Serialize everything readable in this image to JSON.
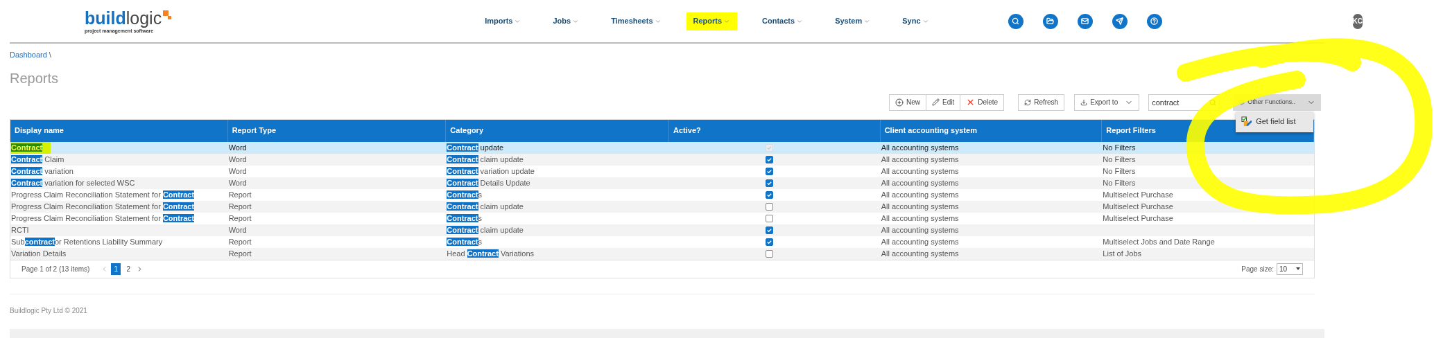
{
  "header": {
    "logo": {
      "brand_bold": "build",
      "brand_light": "logic",
      "tagline": "project management software"
    },
    "nav": [
      {
        "label": "Imports",
        "highlighted": false
      },
      {
        "label": "Jobs",
        "highlighted": false
      },
      {
        "label": "Timesheets",
        "highlighted": false
      },
      {
        "label": "Reports",
        "highlighted": true
      },
      {
        "label": "Contacts",
        "highlighted": false
      },
      {
        "label": "System",
        "highlighted": false
      },
      {
        "label": "Sync",
        "highlighted": false
      }
    ],
    "avatar": {
      "initials": "KC"
    }
  },
  "breadcrumb": {
    "items": [
      "Dashboard"
    ],
    "separator": "\\"
  },
  "page_title": "Reports",
  "toolbar": {
    "buttons": [
      "New",
      "Edit",
      "Delete"
    ],
    "refresh": "Refresh",
    "export": "Export to",
    "search": {
      "value": "contract"
    },
    "other_functions": {
      "label": "Other Functions..",
      "expanded": true,
      "menu": [
        {
          "label": "Get field list"
        }
      ]
    }
  },
  "table": {
    "columns": [
      "Display name",
      "Report Type",
      "Category",
      "Active?",
      "Client accounting system",
      "Report Filters"
    ],
    "rows": [
      {
        "display_name": "**Contract**",
        "report_type": "Word",
        "category": "**Contract** update",
        "active": true,
        "client_accounting_system": "All accounting systems",
        "report_filters": "No Filters",
        "selected": true,
        "highlighted": true
      },
      {
        "display_name": "**Contract** Claim",
        "report_type": "Word",
        "category": "**Contract** claim update",
        "active": true,
        "client_accounting_system": "All accounting systems",
        "report_filters": "No Filters",
        "selected": false,
        "highlighted": false
      },
      {
        "display_name": "**Contract** variation",
        "report_type": "Word",
        "category": "**Contract** variation update",
        "active": true,
        "client_accounting_system": "All accounting systems",
        "report_filters": "No Filters",
        "selected": false,
        "highlighted": false
      },
      {
        "display_name": "**Contract** variation for selected WSC",
        "report_type": "Word",
        "category": "**Contract** Details Update",
        "active": true,
        "client_accounting_system": "All accounting systems",
        "report_filters": "No Filters",
        "selected": false,
        "highlighted": false
      },
      {
        "display_name": "Progress Claim Reconciliation Statement for **Contract**",
        "report_type": "Report",
        "category": "**Contract**s",
        "active": true,
        "client_accounting_system": "All accounting systems",
        "report_filters": "Multiselect Purchase",
        "selected": false,
        "highlighted": false
      },
      {
        "display_name": "Progress Claim Reconciliation Statement for **Contract**",
        "report_type": "Report",
        "category": "**Contract** claim update",
        "active": false,
        "client_accounting_system": "All accounting systems",
        "report_filters": "Multiselect Purchase",
        "selected": false,
        "highlighted": false
      },
      {
        "display_name": "Progress Claim Reconciliation Statement for **Contract**",
        "report_type": "Report",
        "category": "**Contract**s",
        "active": false,
        "client_accounting_system": "All accounting systems",
        "report_filters": "Multiselect Purchase",
        "selected": false,
        "highlighted": false
      },
      {
        "display_name": "RCTI",
        "report_type": "Word",
        "category": "**Contract** claim update",
        "active": true,
        "client_accounting_system": "All accounting systems",
        "selected": false,
        "highlighted": false
      },
      {
        "display_name": "Sub**contract**or Retentions Liability Summary",
        "report_type": "Report",
        "category": "**Contract**s",
        "active": true,
        "client_accounting_system": "All accounting systems",
        "report_filters": "Multiselect Jobs and Date Range",
        "selected": false,
        "highlighted": false
      },
      {
        "display_name": "Variation Details",
        "report_type": "Report",
        "category": "Head **Contract** Variations",
        "active": false,
        "client_accounting_system": "All accounting systems",
        "report_filters": "List of Jobs",
        "selected": false,
        "highlighted": false
      }
    ]
  },
  "pager": {
    "summary": "Page 1 of 2 (13 items)",
    "pages": [
      {
        "label": "1",
        "selected": true
      },
      {
        "label": "2",
        "selected": false
      }
    ],
    "page_size_label": "Page size:",
    "page_size": "10"
  },
  "footer": "Buildlogic Pty Ltd © 2021"
}
